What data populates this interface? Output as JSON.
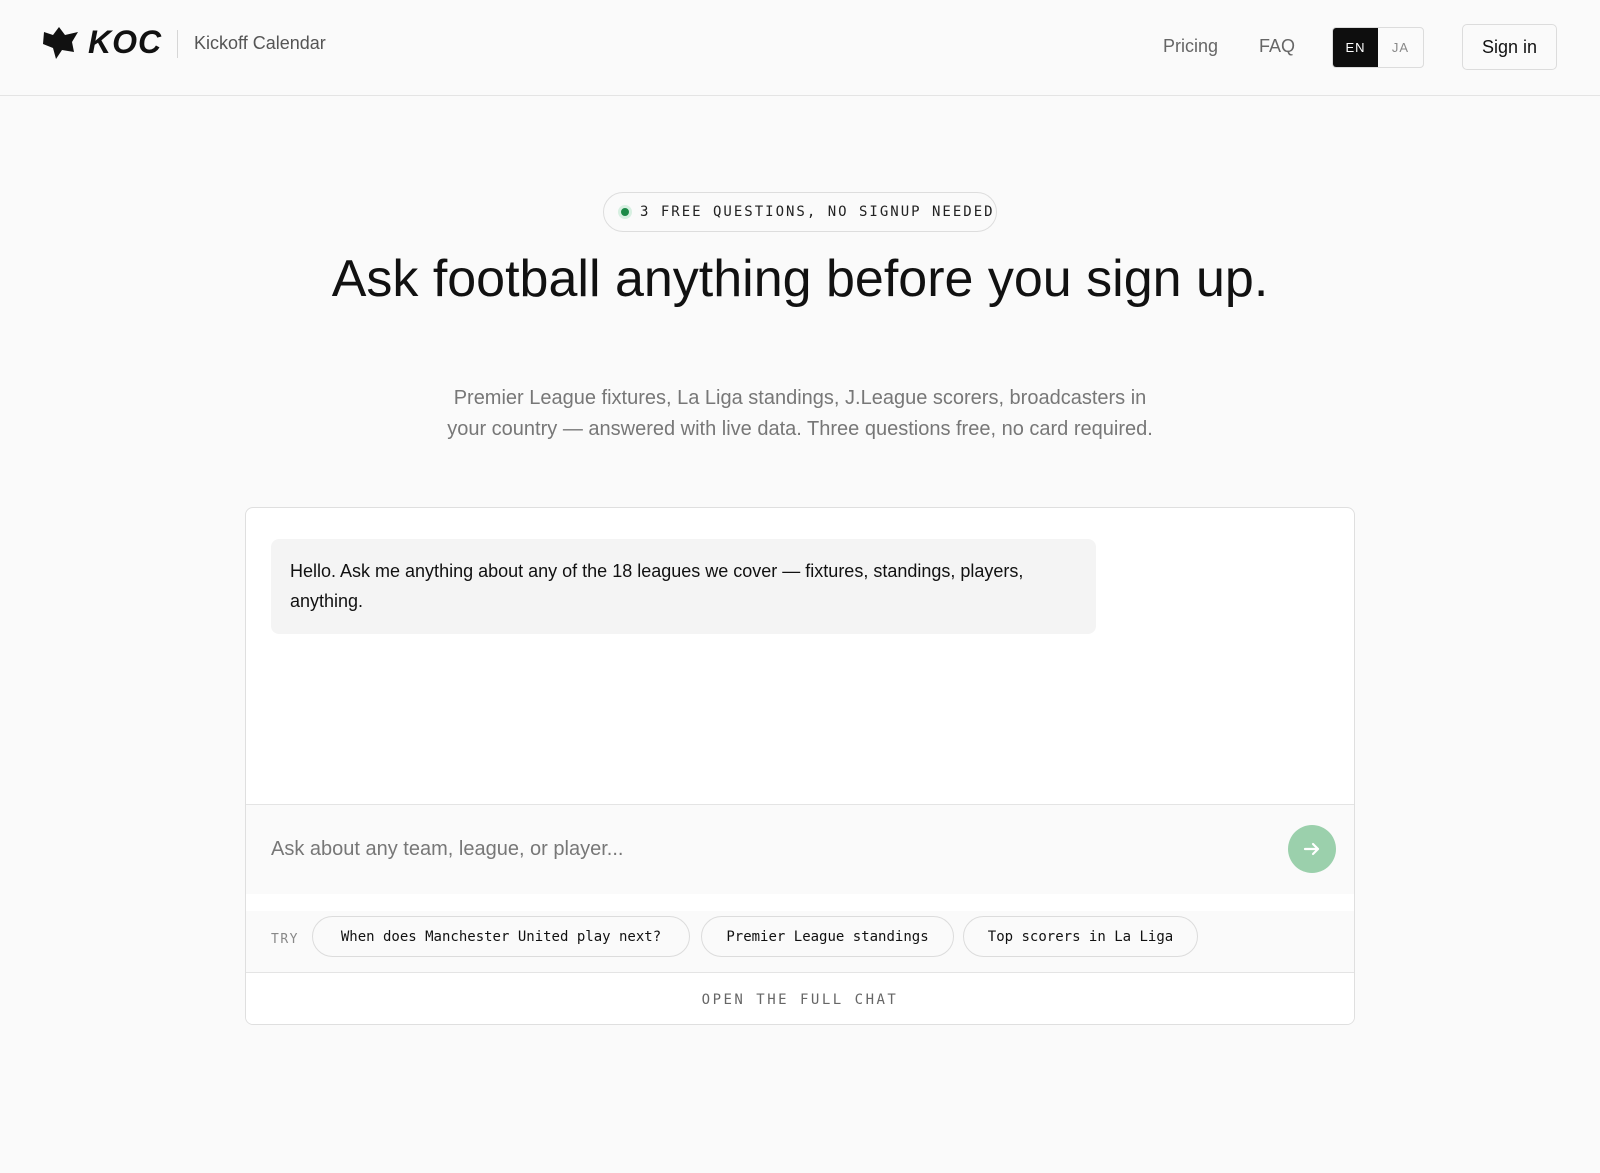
{
  "header": {
    "logo_text": "KOC",
    "brand_name": "Kickoff Calendar",
    "nav": {
      "pricing": "Pricing",
      "faq": "FAQ"
    },
    "languages": [
      {
        "label": "EN",
        "active": true
      },
      {
        "label": "JA",
        "active": false
      }
    ],
    "signin_label": "Sign in"
  },
  "hero": {
    "badge": "3 FREE QUESTIONS, NO SIGNUP NEEDED",
    "title": "Ask football anything before you sign up.",
    "subtitle": "Premier League fixtures, La Liga standings, J.League scorers, broadcasters in your country — answered with live data. Three questions free, no card required."
  },
  "chat": {
    "messages": [
      {
        "role": "assistant",
        "text": "Hello. Ask me anything about any of the 18 leagues we cover — fixtures, standings, players, anything."
      }
    ],
    "input_placeholder": "Ask about any team, league, or player...",
    "input_value": "",
    "try_label": "TRY",
    "suggestions": [
      "When does Manchester United play next?",
      "Premier League standings",
      "Top scorers in La Liga"
    ],
    "open_full_label": "OPEN THE FULL CHAT"
  },
  "colors": {
    "accent_active": "#0e0e0e",
    "send_button": "#9bd0ac",
    "status_dot": "#1c8a48",
    "background": "#fafafa"
  },
  "icons": {
    "logo": "fox-head-logo-icon",
    "send": "arrow-right-icon",
    "badge_dot": "status-dot-icon"
  }
}
